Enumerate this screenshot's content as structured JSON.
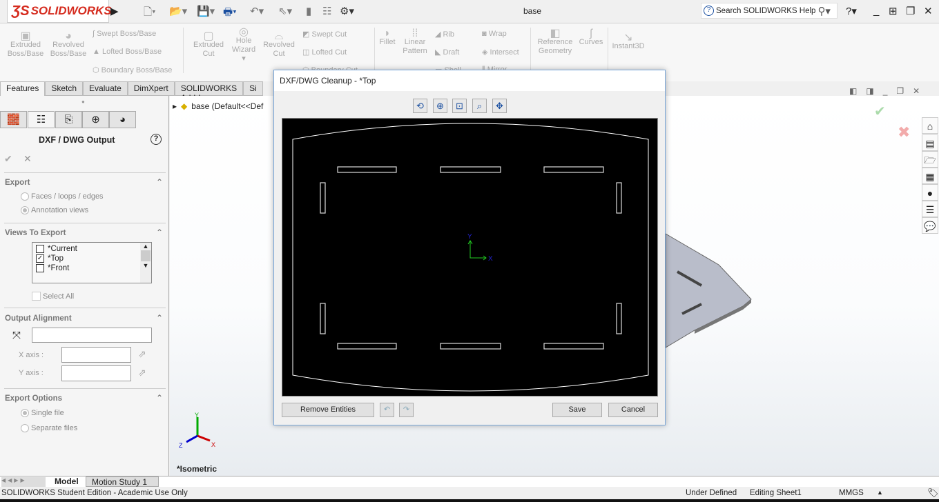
{
  "app": {
    "brand": "SOLIDWORKS",
    "doc_title": "base",
    "search_placeholder": "Search SOLIDWORKS Help"
  },
  "ribbon": {
    "extruded_boss": "Extruded Boss/Base",
    "revolved_boss": "Revolved Boss/Base",
    "swept_boss": "Swept Boss/Base",
    "lofted_boss": "Lofted Boss/Base",
    "boundary_boss": "Boundary Boss/Base",
    "extruded_cut": "Extruded Cut",
    "hole_wizard": "Hole Wizard",
    "revolved_cut": "Revolved Cut",
    "swept_cut": "Swept Cut",
    "lofted_cut": "Lofted Cut",
    "boundary_cut": "Boundary Cut",
    "fillet": "Fillet",
    "linear_pattern": "Linear Pattern",
    "rib": "Rib",
    "draft": "Draft",
    "shell": "Shell",
    "wrap": "Wrap",
    "intersect": "Intersect",
    "mirror": "Mirror",
    "reference_geometry": "Reference Geometry",
    "curves": "Curves",
    "instant3d": "Instant3D"
  },
  "tabs": [
    "Features",
    "Sketch",
    "Evaluate",
    "DimXpert",
    "SOLIDWORKS Add-Ins",
    "Si"
  ],
  "tree": {
    "root": "base  (Default<<Def"
  },
  "panel": {
    "title": "DXF / DWG Output",
    "export": {
      "label": "Export",
      "options": [
        "Faces / loops / edges",
        "Annotation views"
      ],
      "selected": 1
    },
    "views": {
      "label": "Views To Export",
      "items": [
        {
          "label": "*Current",
          "checked": false
        },
        {
          "label": "*Top",
          "checked": true
        },
        {
          "label": "*Front",
          "checked": false
        }
      ],
      "select_all": "Select All"
    },
    "alignment": {
      "label": "Output Alignment",
      "x_axis": "X axis :",
      "y_axis": "Y axis :"
    },
    "export_options": {
      "label": "Export Options",
      "options": [
        "Single file",
        "Separate files"
      ],
      "selected": 0
    }
  },
  "dialog": {
    "title": "DXF/DWG Cleanup - *Top",
    "remove": "Remove Entities",
    "save": "Save",
    "cancel": "Cancel",
    "axis_x": "X",
    "axis_y": "Y"
  },
  "view": {
    "name": "*Isometric",
    "triad": {
      "x": "X",
      "y": "Y",
      "z": "Z"
    }
  },
  "bottom_tabs": [
    "Model",
    "Motion Study 1"
  ],
  "status": {
    "edition": "SOLIDWORKS Student Edition - Academic Use Only",
    "state": "Under Defined",
    "editing": "Editing Sheet1",
    "units": "MMGS"
  }
}
